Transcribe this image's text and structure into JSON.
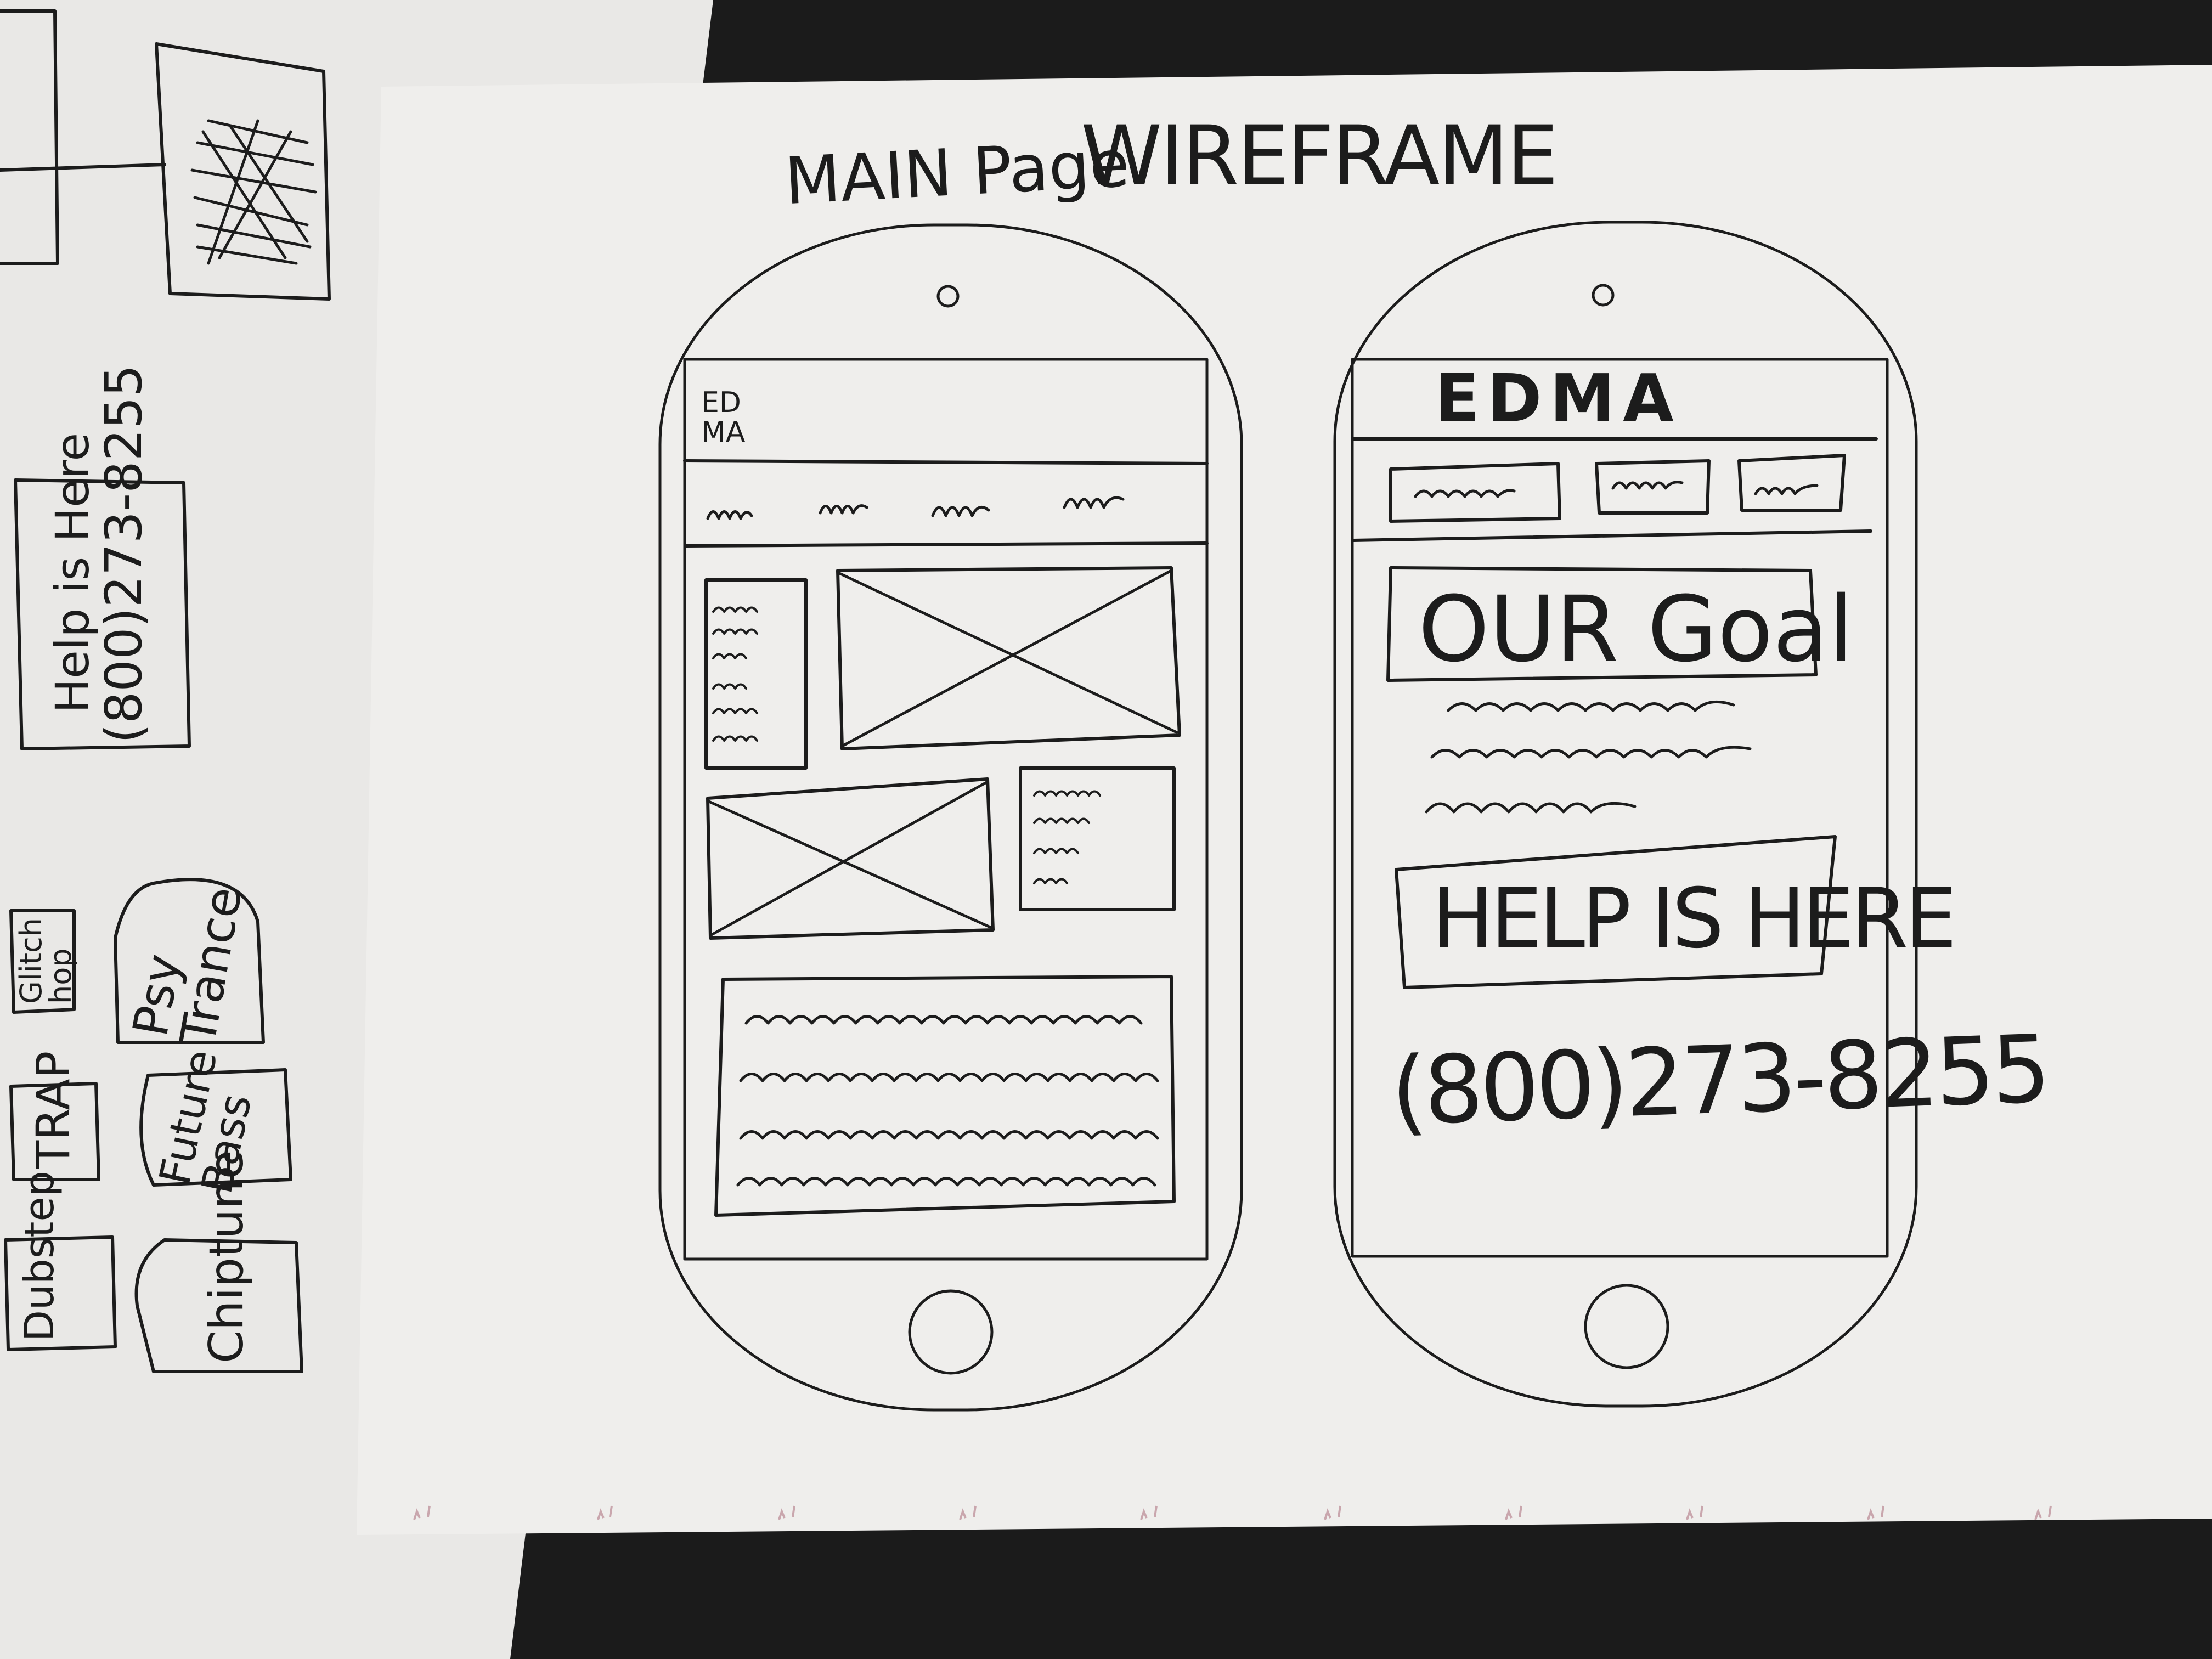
{
  "sheet": {
    "title_small": "MAIN Page",
    "title_large": "WIREFRAME"
  },
  "left_phone": {
    "logo_line1": "ED",
    "logo_line2": "MA"
  },
  "right_phone": {
    "logo": "EDMA",
    "goal_heading": "OUR Goal",
    "help_heading": "HELP IS HERE",
    "phone_number": "(800)273-8255"
  },
  "side_sheet": {
    "help_card_line1": "Help is Here",
    "help_card_line2": "(800)273-8255",
    "genre_cards": [
      {
        "label": "Glitch hop"
      },
      {
        "label": "Psy Trance"
      },
      {
        "label": "TRAP"
      },
      {
        "label": "Future Bass"
      },
      {
        "label": "Dubstep"
      },
      {
        "label": "Chiptune"
      }
    ]
  }
}
